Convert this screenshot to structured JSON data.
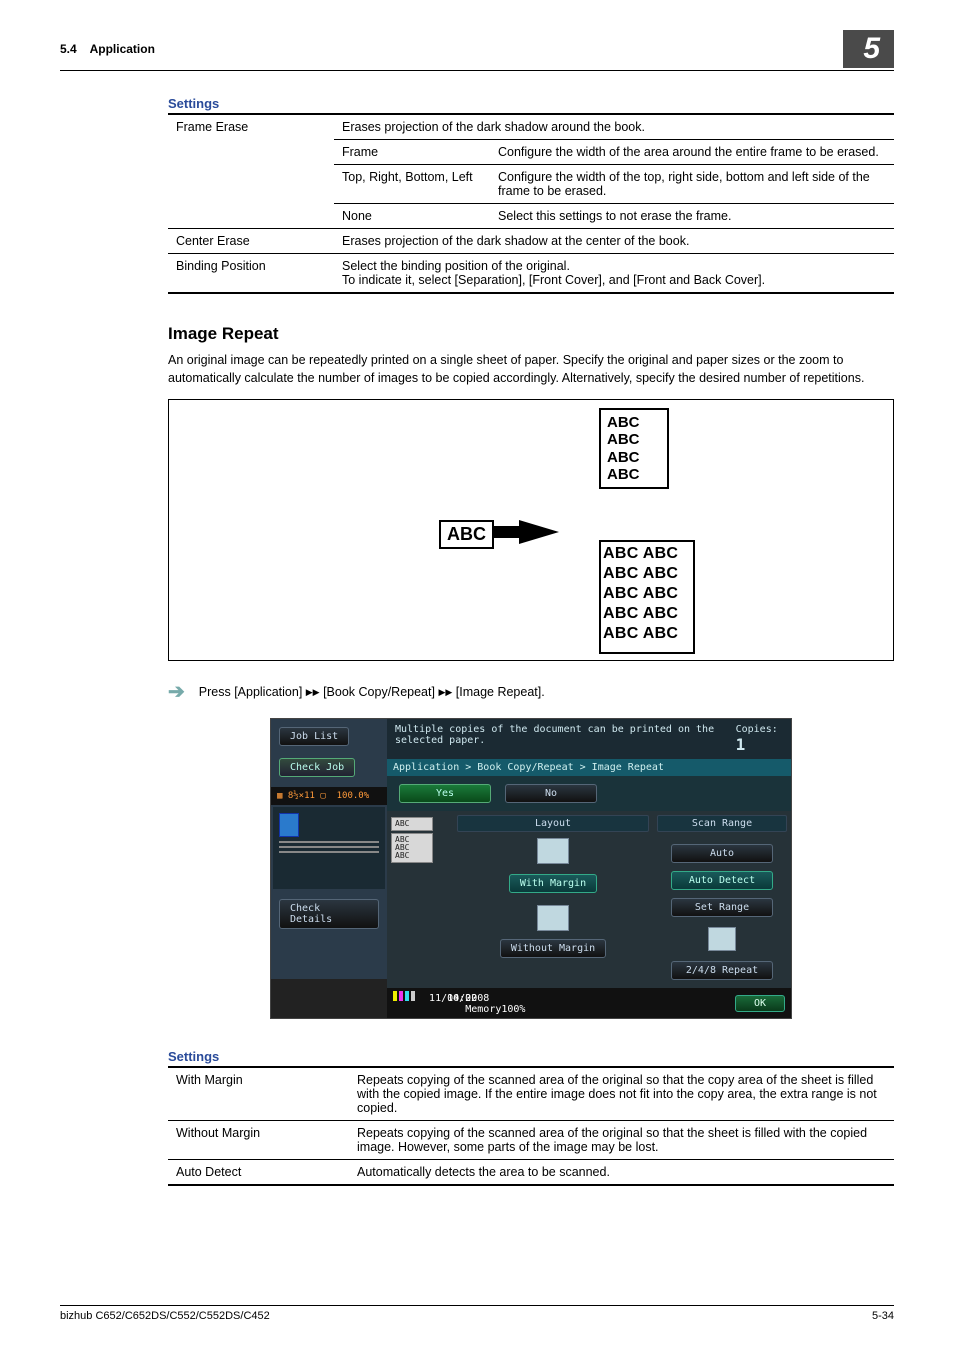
{
  "header": {
    "section_no": "5.4",
    "section_title": "Application",
    "chapter_no": "5"
  },
  "table1": {
    "title": "Settings",
    "r1c1": "Frame Erase",
    "r1c2": "Erases projection of the dark shadow around the book.",
    "r2c2": "Frame",
    "r2c3": "Configure the width of the area around the entire frame to be erased.",
    "r3c2": "Top, Right, Bottom, Left",
    "r3c3": "Configure the width of the top, right side, bottom and left side of the frame to be erased.",
    "r4c2": "None",
    "r4c3": "Select this settings to not erase the frame.",
    "r5c1": "Center Erase",
    "r5c2": "Erases projection of the dark shadow at the center of the book.",
    "r6c1": "Binding Position",
    "r6c2": "Select the binding position of the original.\nTo indicate it, select [Separation], [Front Cover], and [Front and Back Cover]."
  },
  "section": {
    "title": "Image Repeat",
    "para": "An original image can be repeatedly printed on a single sheet of paper. Specify the original and paper sizes or the zoom to automatically calculate the number of images to be copied accordingly. Alternatively, specify the desired number of repetitions."
  },
  "illus": {
    "src": "ABC",
    "out1": "ABC\nABC\nABC\nABC",
    "out2": "ABC ABC\nABC ABC\nABC ABC\nABC ABC\nABC ABC"
  },
  "step": {
    "arrow": "➔",
    "pre": "Press [Application] ",
    "mid1": " [Book Copy/Repeat] ",
    "mid2": " [Image Repeat].",
    "tri": "▶▶"
  },
  "panel": {
    "job_list": "Job List",
    "check_job": "Check Job",
    "paper": "8½×11",
    "zoom": "100.0%",
    "check_details": "Check Details",
    "msg": "Multiple copies of the document can be printed on the selected paper.",
    "copies_lbl": "Copies:",
    "copies_val": "1",
    "breadcrumb": "Application > Book Copy/Repeat > Image Repeat",
    "yes": "Yes",
    "no": "No",
    "layout": "Layout",
    "with_margin": "With Margin",
    "without_margin": "Without Margin",
    "scan_range": "Scan Range",
    "auto": "Auto",
    "auto_detect": "Auto Detect",
    "set_range": "Set Range",
    "repeat248": "2/4/8 Repeat",
    "thumb": "ABC\nABC\nABC",
    "date": "11/04/2008",
    "time": "10:02",
    "mem": "Memory",
    "mem_pct": "100%",
    "ok": "OK"
  },
  "table2": {
    "title": "Settings",
    "r1c1": "With Margin",
    "r1c2": "Repeats copying of the scanned area of the original so that the copy area of the sheet is filled with the copied image. If the entire image does not fit into the copy area, the extra range is not copied.",
    "r2c1": "Without Margin",
    "r2c2": "Repeats copying of the scanned area of the original so that the sheet is filled with the copied image. However, some parts of the image may be lost.",
    "r3c1": "Auto Detect",
    "r3c2": "Automatically detects the area to be scanned."
  },
  "footer": {
    "model": "bizhub C652/C652DS/C552/C552DS/C452",
    "page": "5-34"
  }
}
